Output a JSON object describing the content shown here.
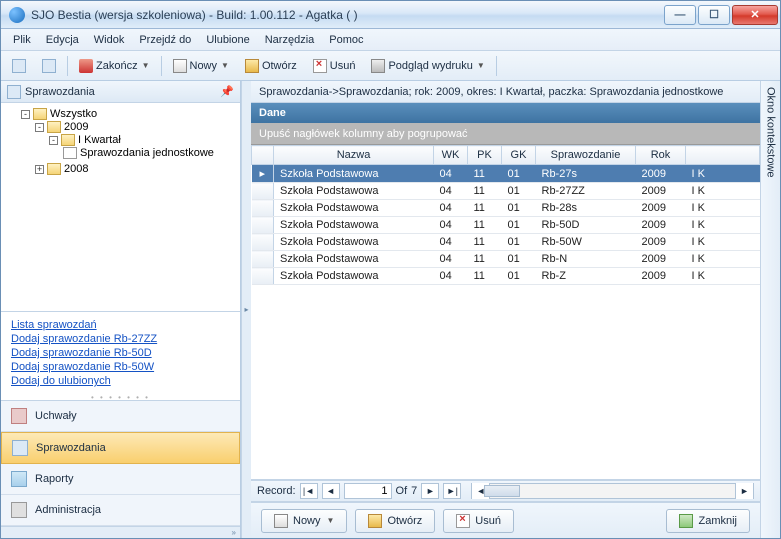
{
  "title": "SJO Bestia (wersja szkoleniowa) - Build: 1.00.112 - Agatka ( )",
  "menu": [
    "Plik",
    "Edycja",
    "Widok",
    "Przejdź do",
    "Ulubione",
    "Narzędzia",
    "Pomoc"
  ],
  "toolbar": {
    "zakoncz": "Zakończ",
    "nowy": "Nowy",
    "otworz": "Otwórz",
    "usun": "Usuń",
    "podglad": "Podgląd wydruku"
  },
  "left": {
    "header": "Sprawozdania",
    "tree": {
      "root": "Wszystko",
      "y2009": "2009",
      "q1": "I Kwartał",
      "leaf": "Sprawozdania jednostkowe",
      "y2008": "2008"
    },
    "links": [
      "Lista sprawozdań",
      "Dodaj sprawozdanie Rb-27ZZ",
      "Dodaj sprawozdanie Rb-50D",
      "Dodaj sprawozdanie Rb-50W",
      "Dodaj do ulubionych"
    ],
    "nav": {
      "uchwaly": "Uchwały",
      "sprawozdania": "Sprawozdania",
      "raporty": "Raporty",
      "administracja": "Administracja"
    }
  },
  "right": {
    "breadcrumb": "Sprawozdania->Sprawozdania; rok: 2009, okres: I Kwartał, paczka: Sprawozdania jednostkowe",
    "section": "Dane",
    "grouphint": "Upuść nagłówek kolumny aby pogrupować",
    "cols": [
      "Nazwa",
      "WK",
      "PK",
      "GK",
      "Sprawozdanie",
      "Rok",
      ""
    ],
    "rows": [
      {
        "n": "Szkoła Podstawowa",
        "wk": "04",
        "pk": "11",
        "gk": "01",
        "sp": "Rb-27s",
        "rok": "2009",
        "x": "I K",
        "sel": true
      },
      {
        "n": "Szkoła Podstawowa",
        "wk": "04",
        "pk": "11",
        "gk": "01",
        "sp": "Rb-27ZZ",
        "rok": "2009",
        "x": "I K"
      },
      {
        "n": "Szkoła Podstawowa",
        "wk": "04",
        "pk": "11",
        "gk": "01",
        "sp": "Rb-28s",
        "rok": "2009",
        "x": "I K"
      },
      {
        "n": "Szkoła Podstawowa",
        "wk": "04",
        "pk": "11",
        "gk": "01",
        "sp": "Rb-50D",
        "rok": "2009",
        "x": "I K"
      },
      {
        "n": "Szkoła Podstawowa",
        "wk": "04",
        "pk": "11",
        "gk": "01",
        "sp": "Rb-50W",
        "rok": "2009",
        "x": "I K"
      },
      {
        "n": "Szkoła Podstawowa",
        "wk": "04",
        "pk": "11",
        "gk": "01",
        "sp": "Rb-N",
        "rok": "2009",
        "x": "I K"
      },
      {
        "n": "Szkoła Podstawowa",
        "wk": "04",
        "pk": "11",
        "gk": "01",
        "sp": "Rb-Z",
        "rok": "2009",
        "x": "I K"
      }
    ],
    "record": {
      "label": "Record:",
      "cur": "1",
      "of": "Of",
      "total": "7"
    },
    "buttons": {
      "nowy": "Nowy",
      "otworz": "Otwórz",
      "usun": "Usuń",
      "zamknij": "Zamknij"
    }
  },
  "sidetab": "Okno kontekstowe"
}
